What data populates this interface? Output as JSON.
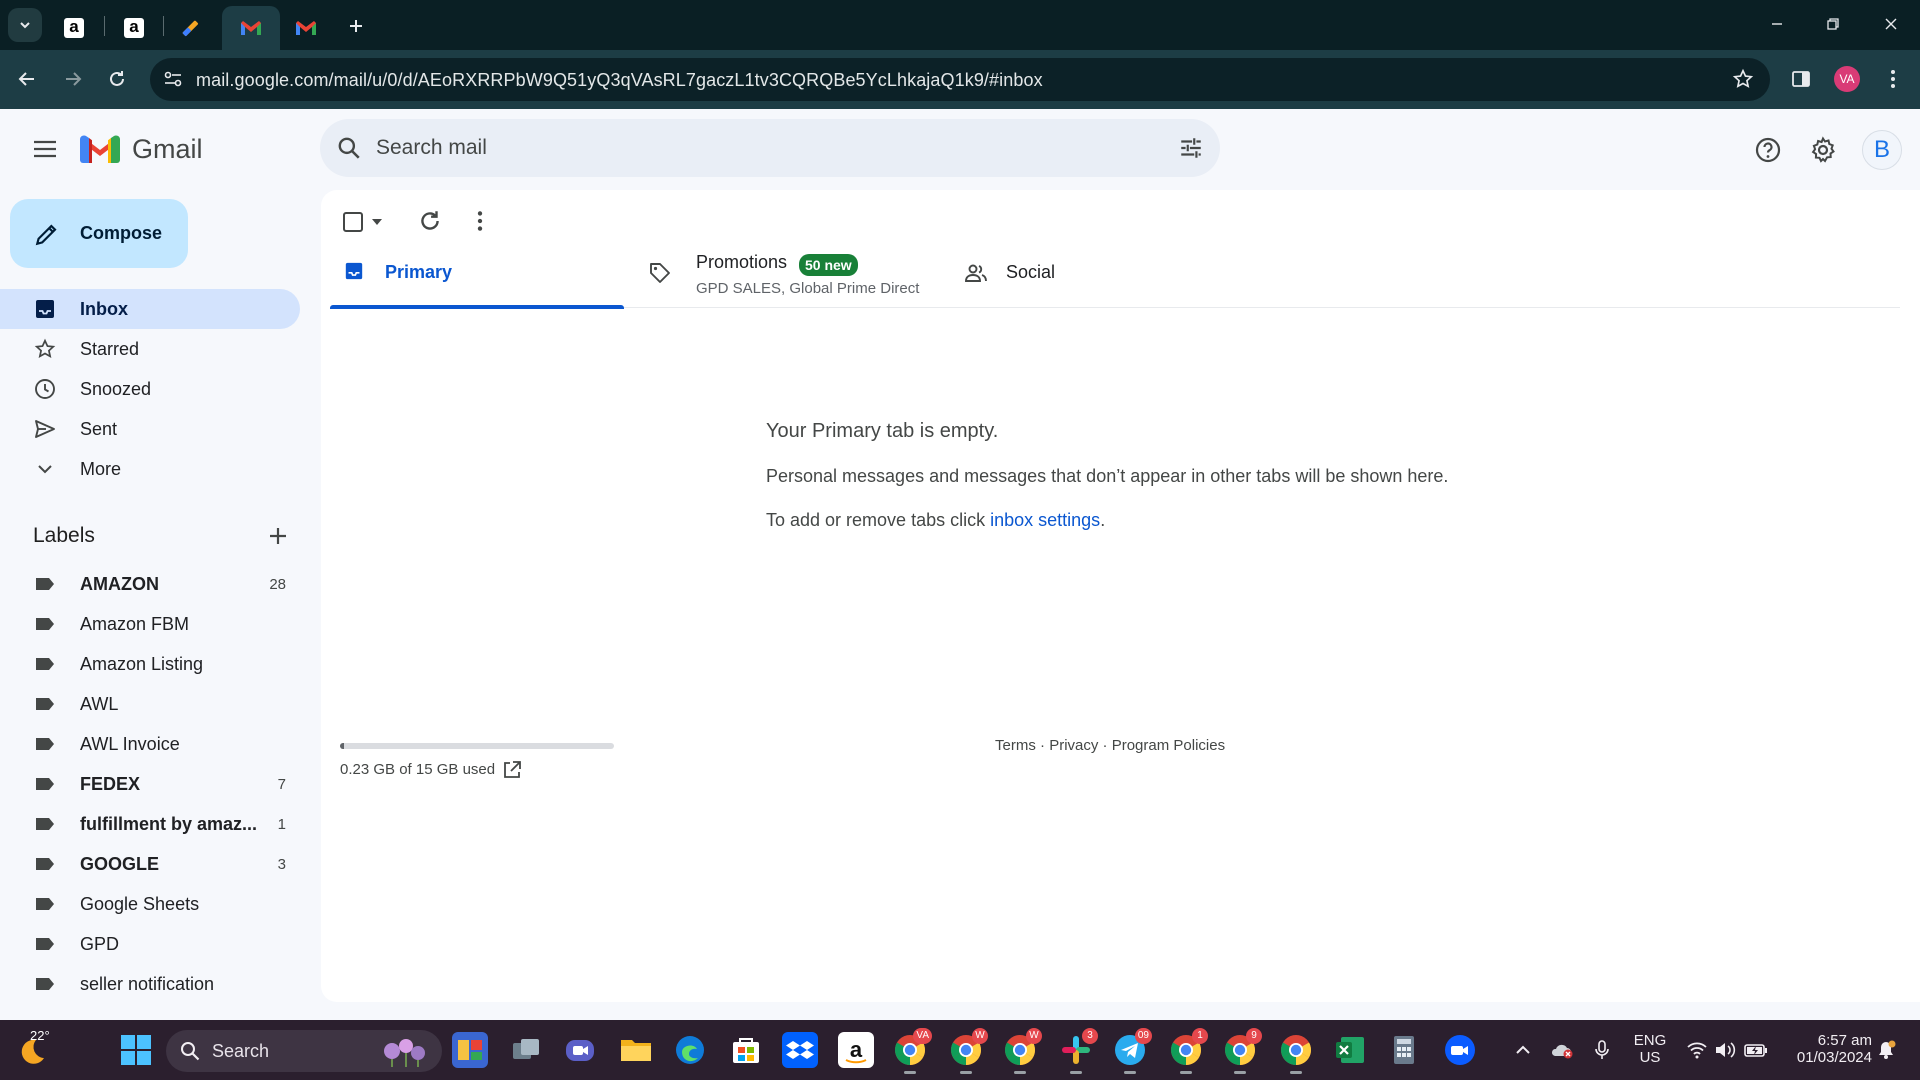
{
  "browser": {
    "url": "mail.google.com/mail/u/0/d/AEoRXRRPbW9Q51yQ3qVAsRL7gaczL1tv3CQRQBe5YcLhkajaQ1k9/#inbox",
    "profile_initials": "VA"
  },
  "gmail": {
    "wordmark": "Gmail",
    "search_placeholder": "Search mail",
    "account_initial": "B",
    "compose_label": "Compose",
    "nav": [
      {
        "label": "Inbox",
        "icon": "inbox-icon",
        "active": true
      },
      {
        "label": "Starred",
        "icon": "star-icon"
      },
      {
        "label": "Snoozed",
        "icon": "clock-icon"
      },
      {
        "label": "Sent",
        "icon": "send-icon"
      },
      {
        "label": "More",
        "icon": "chevron-down-icon"
      }
    ],
    "labels_heading": "Labels",
    "labels": [
      {
        "name": "AMAZON",
        "count": "28",
        "bold": true
      },
      {
        "name": "Amazon FBM",
        "count": ""
      },
      {
        "name": "Amazon Listing",
        "count": ""
      },
      {
        "name": "AWL",
        "count": ""
      },
      {
        "name": "AWL Invoice",
        "count": ""
      },
      {
        "name": "FEDEX",
        "count": "7",
        "bold": true
      },
      {
        "name": "fulfillment by amaz...",
        "count": "1",
        "bold": true
      },
      {
        "name": "GOOGLE",
        "count": "3",
        "bold": true
      },
      {
        "name": "Google Sheets",
        "count": ""
      },
      {
        "name": "GPD",
        "count": ""
      },
      {
        "name": "seller notification",
        "count": ""
      }
    ],
    "tabs": {
      "primary": "Primary",
      "promotions": "Promotions",
      "promotions_badge": "50 new",
      "promotions_sub": "GPD SALES, Global Prime Direct",
      "social": "Social"
    },
    "empty": {
      "title": "Your Primary tab is empty.",
      "line1": "Personal messages and messages that don’t appear in other tabs will be shown here.",
      "line2_prefix": "To add or remove tabs click ",
      "line2_link": "inbox settings",
      "line2_suffix": "."
    },
    "storage": {
      "text": "0.23 GB of 15 GB used",
      "fraction_used": 0.015
    },
    "footer": {
      "terms": "Terms",
      "privacy": "Privacy",
      "policies": "Program Policies",
      "sep": " · "
    }
  },
  "taskbar": {
    "weather_temp": "22°",
    "search_label": "Search",
    "lang": "ENG",
    "region": "US",
    "time": "6:57 am",
    "date": "01/03/2024",
    "badges": {
      "chrome_profile_1": "VA",
      "chrome_profile_2": "W",
      "chrome_profile_3": "W",
      "slack": "3",
      "telegram": "09",
      "chrome_profile_4": "1",
      "chrome_profile_5": "9"
    }
  },
  "colors": {
    "accent": "#0b57d0",
    "compose_bg": "#c2e7ff",
    "active_nav_bg": "#d3e3fd",
    "promo_badge": "#188038"
  }
}
